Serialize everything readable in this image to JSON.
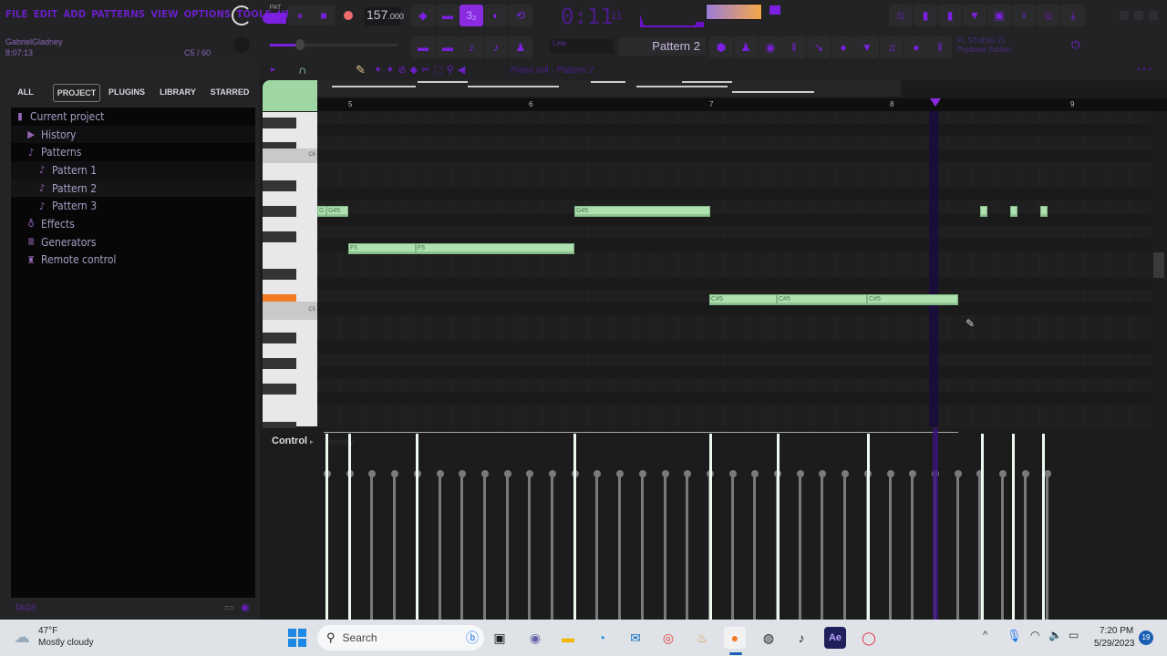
{
  "app": {
    "menu": [
      "FILE",
      "EDIT",
      "ADD",
      "PATTERNS",
      "VIEW",
      "OPTIONS",
      "TOOLS",
      "HELP"
    ],
    "user": "GabrielGladney",
    "clock": "8:07:13",
    "cpu_info": "C5 / 60",
    "pat_song_mode": "PAT",
    "tempo": "157",
    "tempo_decimal": ".000",
    "song_time": "0:11",
    "song_time_sub": "11",
    "pattern_name": "Pattern 2",
    "hint_line1": "FL STUDIO 21",
    "hint_line2": "Producer Edition",
    "colors": {
      "accent": "#8a2be2",
      "note": "#aee0b0",
      "playhead": "#8a2be2",
      "key_highlight": "#f07a24"
    }
  },
  "browser": {
    "tabs": [
      "ALL",
      "PROJECT",
      "PLUGINS",
      "LIBRARY",
      "STARRED"
    ],
    "selected_tab": "PROJECT",
    "tree": [
      {
        "label": "Current project",
        "icon": "document-icon",
        "level": 0
      },
      {
        "label": "History",
        "icon": "history-icon",
        "level": 1
      },
      {
        "label": "Patterns",
        "icon": "note-icon",
        "level": 1
      },
      {
        "label": "Pattern 1",
        "icon": "note-icon",
        "level": 2
      },
      {
        "label": "Pattern 2",
        "icon": "note-icon",
        "level": 2
      },
      {
        "label": "Pattern 3",
        "icon": "note-icon",
        "level": 2
      },
      {
        "label": "Effects",
        "icon": "effects-icon",
        "level": 1
      },
      {
        "label": "Generators",
        "icon": "generators-icon",
        "level": 1
      },
      {
        "label": "Remote control",
        "icon": "remote-icon",
        "level": 1
      }
    ],
    "footer": "TAGS"
  },
  "pianoroll": {
    "toolbar_text": "Piano roll - Pattern 2",
    "ruler": [
      "5",
      "6",
      "7",
      "8",
      "9"
    ],
    "key_labels": [
      "C6",
      "C5"
    ],
    "notes": [
      {
        "label": "G",
        "pitch": "G5"
      },
      {
        "label": "G#5",
        "pitch": "G#5"
      },
      {
        "label": "F5",
        "pitch": "F5"
      },
      {
        "label": "F5",
        "pitch": "F5"
      },
      {
        "label": "G#5",
        "pitch": "G#5"
      },
      {
        "label": "C#5",
        "pitch": "C#5"
      },
      {
        "label": "C#5",
        "pitch": "C#5"
      },
      {
        "label": "C#5",
        "pitch": "C#5"
      },
      {
        "label": "",
        "pitch": "G#5"
      },
      {
        "label": "",
        "pitch": "G#5"
      },
      {
        "label": "",
        "pitch": "G#5"
      }
    ],
    "event_editor": {
      "label": "Control",
      "target": "Velocity"
    }
  },
  "taskbar": {
    "weather_temp": "47°F",
    "weather_desc": "Mostly cloudy",
    "search_placeholder": "Search",
    "time": "7:20 PM",
    "date": "5/29/2023",
    "notifications": "19",
    "apps": [
      "Start",
      "Search",
      "Copilot",
      "Task View",
      "Teams",
      "File Explorer",
      "Edge",
      "Mail",
      "Chrome",
      "App",
      "FL Studio",
      "OBS",
      "Music",
      "After Effects",
      "Opera"
    ]
  }
}
